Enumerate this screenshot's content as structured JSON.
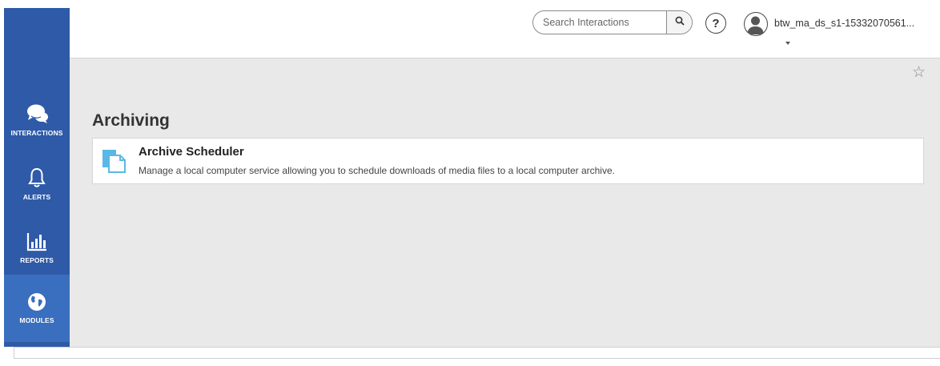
{
  "sidebar": {
    "items": [
      {
        "label": "INTERACTIONS",
        "icon": "chat-bubbles-icon"
      },
      {
        "label": "ALERTS",
        "icon": "bell-icon"
      },
      {
        "label": "REPORTS",
        "icon": "bar-chart-icon"
      },
      {
        "label": "MODULES",
        "icon": "globe-icon",
        "active": true
      }
    ]
  },
  "header": {
    "search_placeholder": "Search Interactions",
    "help_glyph": "?",
    "username": "btw_ma_ds_s1-15332070561..."
  },
  "main": {
    "title": "Archiving",
    "favorite_glyph": "☆",
    "cards": [
      {
        "title": "Archive Scheduler",
        "description": "Manage a local computer service allowing you to schedule downloads of media files to a local computer archive.",
        "icon": "document-icon"
      }
    ]
  },
  "colors": {
    "sidebar_bg": "#2e5aa8",
    "sidebar_active": "#3a6ebf",
    "main_bg": "#e9e9e9",
    "card_icon": "#5ab8e6"
  }
}
